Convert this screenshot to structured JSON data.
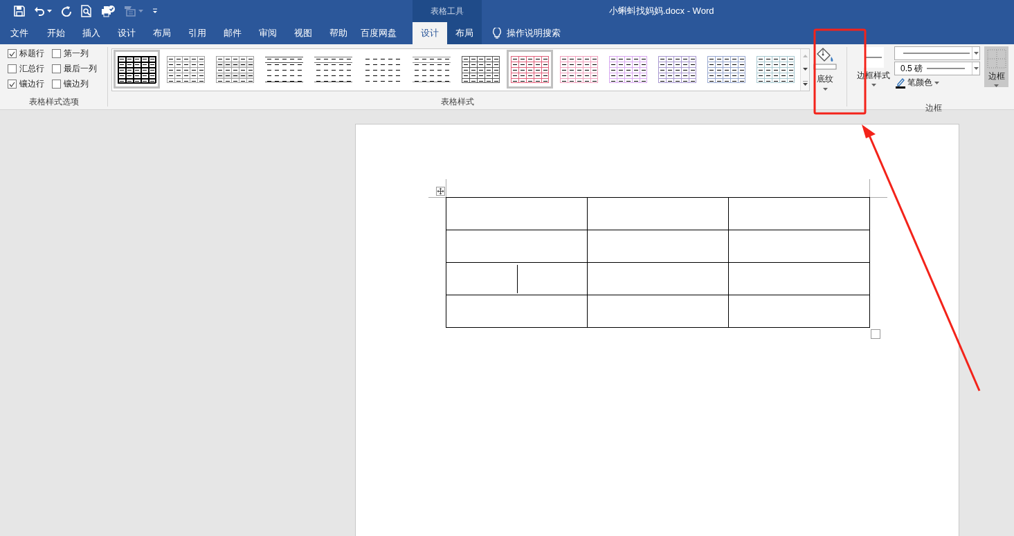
{
  "window": {
    "title": "小蝌蚪找妈妈.docx  -  Word",
    "context_label": "表格工具"
  },
  "quick_access": [
    {
      "kind": "save",
      "disabled": false
    },
    {
      "kind": "undo",
      "disabled": false
    },
    {
      "kind": "redo",
      "disabled": false
    },
    {
      "kind": "preview",
      "disabled": false
    },
    {
      "kind": "check",
      "disabled": false
    },
    {
      "kind": "form",
      "disabled": true
    },
    {
      "kind": "customize",
      "disabled": false
    }
  ],
  "tabs": [
    {
      "label": "文件",
      "selected": false,
      "contextual": false
    },
    {
      "label": "开始",
      "selected": false,
      "contextual": false
    },
    {
      "label": "插入",
      "selected": false,
      "contextual": false
    },
    {
      "label": "设计",
      "selected": false,
      "contextual": false
    },
    {
      "label": "布局",
      "selected": false,
      "contextual": false
    },
    {
      "label": "引用",
      "selected": false,
      "contextual": false
    },
    {
      "label": "邮件",
      "selected": false,
      "contextual": false
    },
    {
      "label": "审阅",
      "selected": false,
      "contextual": false
    },
    {
      "label": "视图",
      "selected": false,
      "contextual": false
    },
    {
      "label": "帮助",
      "selected": false,
      "contextual": false
    },
    {
      "label": "百度网盘",
      "selected": false,
      "contextual": false
    },
    {
      "label": "设计",
      "selected": true,
      "contextual": true
    },
    {
      "label": "布局",
      "selected": false,
      "contextual": true
    }
  ],
  "tell_me": {
    "label": "操作说明搜索"
  },
  "style_options": {
    "label": "表格样式选项",
    "items": [
      {
        "label": "标题行",
        "checked": true
      },
      {
        "label": "第一列",
        "checked": false
      },
      {
        "label": "汇总行",
        "checked": false
      },
      {
        "label": "最后一列",
        "checked": false
      },
      {
        "label": "镶边行",
        "checked": true
      },
      {
        "label": "镶边列",
        "checked": false
      }
    ]
  },
  "table_styles": {
    "label": "表格样式",
    "items": [
      {
        "kind": "grid",
        "color": "#000000",
        "selected": true
      },
      {
        "kind": "grid",
        "color": "#a0a0a0",
        "selected": false
      },
      {
        "kind": "shaded",
        "color": "#a0a0a0",
        "selected": false
      },
      {
        "kind": "lines",
        "color": "#555555",
        "selected": false
      },
      {
        "kind": "lines",
        "color": "#777777",
        "selected": false
      },
      {
        "kind": "plain",
        "color": "#000000",
        "selected": false
      },
      {
        "kind": "lines",
        "color": "#999999",
        "selected": false
      },
      {
        "kind": "grid",
        "color": "#555555",
        "selected": false
      },
      {
        "kind": "grid",
        "color": "#e0607a",
        "selected": true
      },
      {
        "kind": "grid",
        "color": "#f0a0bc",
        "selected": false
      },
      {
        "kind": "grid",
        "color": "#d8a8f0",
        "selected": false
      },
      {
        "kind": "grid",
        "color": "#a898d0",
        "selected": false
      },
      {
        "kind": "grid",
        "color": "#98a8d0",
        "selected": false
      },
      {
        "kind": "grid",
        "color": "#a8c8d0",
        "selected": false
      }
    ]
  },
  "shading": {
    "label": "底纹"
  },
  "borders": {
    "label": "边框",
    "style_label": "边框样式",
    "weight": "0.5 磅",
    "pen_color_label": "笔颜色",
    "button_label": "边框"
  },
  "document_table": {
    "rows": [
      {
        "cells": [
          {
            "kind": "plain"
          },
          {
            "kind": "plain"
          },
          {
            "kind": "plain"
          }
        ]
      },
      {
        "cells": [
          {
            "kind": "plain"
          },
          {
            "kind": "plain"
          },
          {
            "kind": "plain"
          }
        ]
      },
      {
        "cells": [
          {
            "kind": "split"
          },
          {
            "kind": "plain"
          },
          {
            "kind": "plain"
          }
        ]
      },
      {
        "cells": [
          {
            "kind": "plain"
          },
          {
            "kind": "plain"
          },
          {
            "kind": "plain"
          }
        ]
      }
    ]
  }
}
